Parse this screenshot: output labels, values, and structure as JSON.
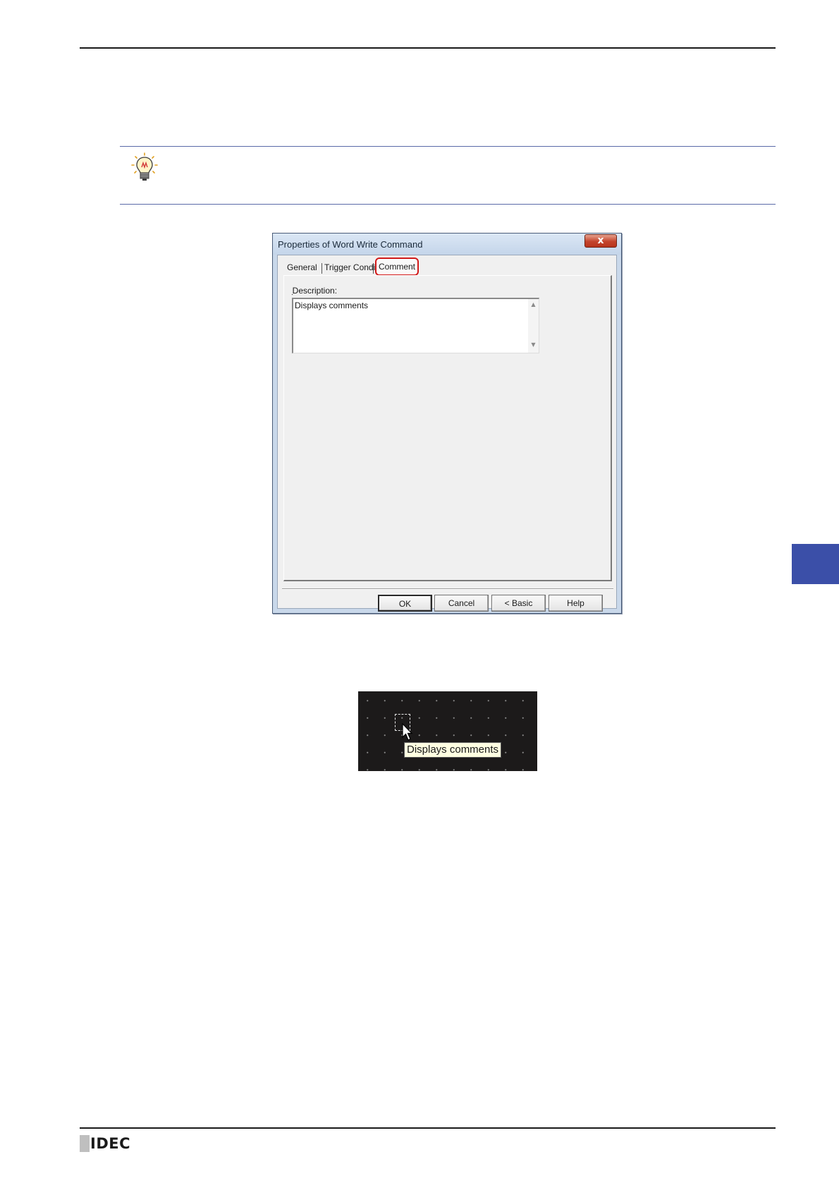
{
  "dialog": {
    "title": "Properties of Word Write Command",
    "close_label": "x",
    "tabs": [
      {
        "label": "General"
      },
      {
        "label": "Trigger Condition"
      },
      {
        "label": "Comment"
      }
    ],
    "description_label": "Description:",
    "description_value": "Displays comments",
    "buttons": {
      "ok": "OK",
      "cancel": "Cancel",
      "basic": "< Basic",
      "help": "Help"
    }
  },
  "preview": {
    "tooltip_text": "Displays comments"
  },
  "footer": {
    "logo_text": "IDEC"
  },
  "icons": {
    "hint": "lightbulb-icon",
    "cursor": "mouse-pointer-icon"
  },
  "colors": {
    "highlight": "#d21a1a",
    "side_tab": "#3b4fa8"
  }
}
